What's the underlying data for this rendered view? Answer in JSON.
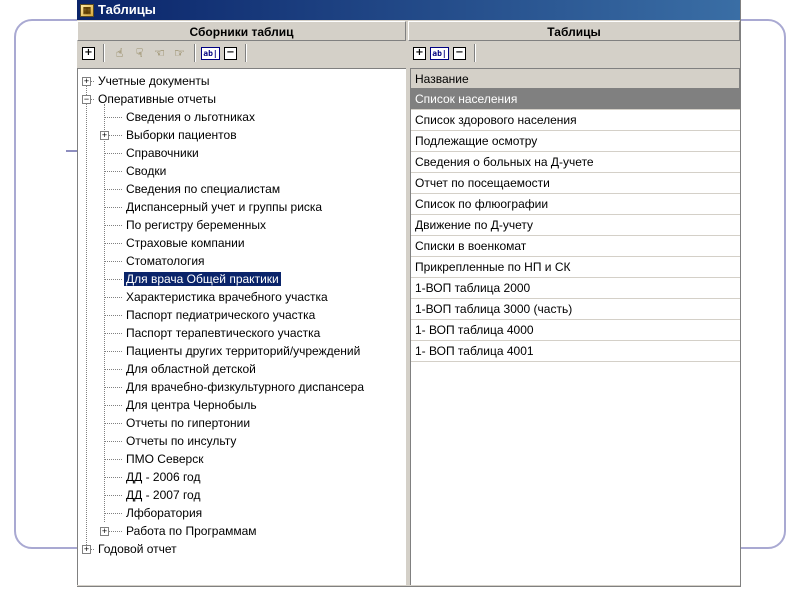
{
  "window": {
    "title": "Таблицы"
  },
  "left_panel": {
    "header": "Сборники таблиц",
    "toolbar": {
      "buttons": [
        {
          "name": "add-button",
          "glyph": "+"
        },
        {
          "name": "move-up-button",
          "glyph": "☝"
        },
        {
          "name": "move-down-button",
          "glyph": "☟"
        },
        {
          "name": "move-left-button",
          "glyph": "☜"
        },
        {
          "name": "move-right-button",
          "glyph": "☞"
        },
        {
          "name": "rename-button",
          "glyph": "ab|"
        },
        {
          "name": "remove-button",
          "glyph": "−"
        }
      ]
    },
    "tree": [
      {
        "label": "Учетные документы",
        "level": 0,
        "expander": "plus"
      },
      {
        "label": "Оперативные отчеты",
        "level": 0,
        "expander": "minus"
      },
      {
        "label": "Сведения о льготниках",
        "level": 1
      },
      {
        "label": "Выборки пациентов",
        "level": 1,
        "expander": "plus"
      },
      {
        "label": "Справочники",
        "level": 1
      },
      {
        "label": "Сводки",
        "level": 1
      },
      {
        "label": "Сведения по специалистам",
        "level": 1
      },
      {
        "label": "Диспансерный учет и группы риска",
        "level": 1
      },
      {
        "label": "По регистру беременных",
        "level": 1
      },
      {
        "label": "Страховые компании",
        "level": 1
      },
      {
        "label": "Стоматология",
        "level": 1
      },
      {
        "label": "Для врача Общей практики",
        "level": 1,
        "selected": true
      },
      {
        "label": "Характеристика врачебного участка",
        "level": 1
      },
      {
        "label": "Паспорт педиатрического участка",
        "level": 1
      },
      {
        "label": "Паспорт терапевтического участка",
        "level": 1
      },
      {
        "label": "Пациенты других территорий/учреждений",
        "level": 1
      },
      {
        "label": "Для областной детской",
        "level": 1
      },
      {
        "label": "Для врачебно-физкультурного диспансера",
        "level": 1
      },
      {
        "label": "Для центра Чернобыль",
        "level": 1
      },
      {
        "label": "Отчеты по гипертонии",
        "level": 1
      },
      {
        "label": "Отчеты по инсульту",
        "level": 1
      },
      {
        "label": "ПМО Северск",
        "level": 1
      },
      {
        "label": "ДД - 2006 год",
        "level": 1
      },
      {
        "label": "ДД - 2007 год",
        "level": 1
      },
      {
        "label": "Лфборатория",
        "level": 1
      },
      {
        "label": "Работа по Программам",
        "level": 1,
        "expander": "plus"
      },
      {
        "label": "Годовой отчет",
        "level": 0,
        "expander": "plus"
      }
    ]
  },
  "right_panel": {
    "header": "Таблицы",
    "toolbar": {
      "buttons": [
        {
          "name": "add-table-button",
          "glyph": "+"
        },
        {
          "name": "rename-table-button",
          "glyph": "ab|"
        },
        {
          "name": "remove-table-button",
          "glyph": "−"
        }
      ]
    },
    "column_header": "Название",
    "rows": [
      {
        "label": "Список населения",
        "selected": true
      },
      {
        "label": "Список здорового населения"
      },
      {
        "label": "Подлежащие осмотру"
      },
      {
        "label": "Сведения о больных на Д-учете"
      },
      {
        "label": "Отчет по посещаемости"
      },
      {
        "label": "Список по флюографии"
      },
      {
        "label": "Движение по Д-учету"
      },
      {
        "label": "Списки в военкомат"
      },
      {
        "label": "Прикрепленные по НП и СК"
      },
      {
        "label": "1-ВОП таблица 2000"
      },
      {
        "label": "1-ВОП таблица 3000 (часть)"
      },
      {
        "label": "1- ВОП таблица 4000"
      },
      {
        "label": "1- ВОП таблица 4001"
      }
    ]
  }
}
